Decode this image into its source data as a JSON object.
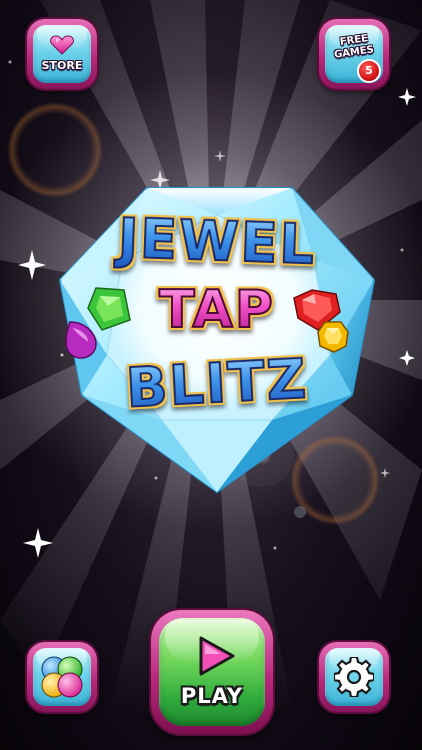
{
  "game": {
    "title_line_1": "JEWEL",
    "title_line_2": "TAP",
    "title_line_3": "BLITZ"
  },
  "top_bar": {
    "store_label": "STORE",
    "free_games_line_1": "FREE",
    "free_games_line_2": "GAMES",
    "free_games_badge": "5"
  },
  "bottom_bar": {
    "play_label": "PLAY"
  },
  "icons": {
    "store": "heart-gem-icon",
    "colors": "color-balls-icon",
    "settings": "gear-icon",
    "play": "play-triangle-icon"
  },
  "colors": {
    "button_frame": "#b8287c",
    "button_face": "#6fd3ea",
    "play_face": "#4fc24a",
    "title_blue": "#2f7fe0",
    "title_pink": "#f04ec4",
    "title_outline": "#f2c14a",
    "badge": "#d41818"
  }
}
